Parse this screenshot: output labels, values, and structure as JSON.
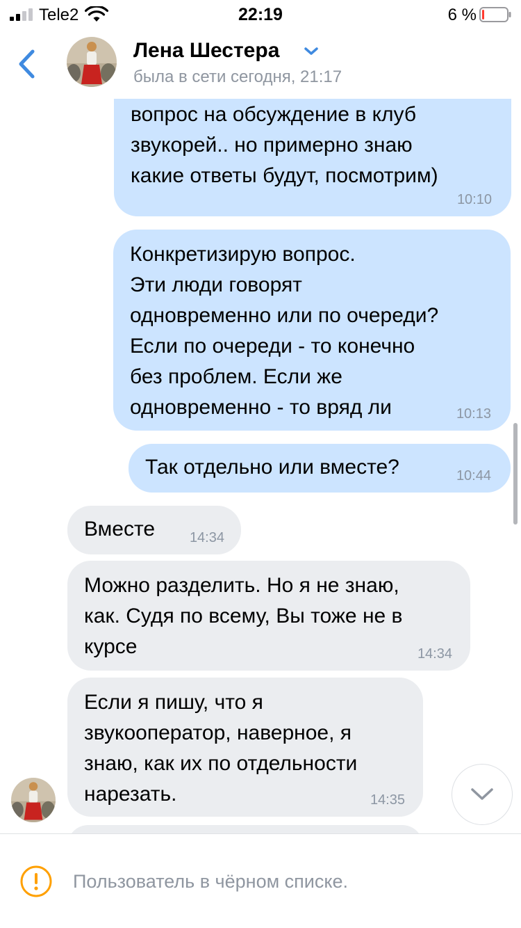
{
  "status_bar": {
    "carrier": "Tele2",
    "time": "22:19",
    "battery_percent": "6 %",
    "signal_bars": 2,
    "battery_level": 0.06,
    "battery_color": "#ff3b30"
  },
  "header": {
    "back_icon": "chevron-left-icon",
    "contact_name": "Лена Шестера",
    "last_seen": "была в сети сегодня, 21:17",
    "accent_color": "#3f8ae0"
  },
  "messages": [
    {
      "direction": "outgoing",
      "text": "вопрос на обсуждение в клуб\nзвукорей.. но примерно знаю\nкакие ответы будут, посмотрим)",
      "time": "10:10"
    },
    {
      "direction": "outgoing",
      "text": "Конкретизирую вопрос.\nЭти люди говорят\nодновременно или по очереди?\nЕсли по очереди - то конечно\nбез проблем. Если же\nодновременно - то вряд ли",
      "time": "10:13"
    },
    {
      "direction": "outgoing",
      "text": "Так отдельно или вместе?",
      "time": "10:44"
    },
    {
      "direction": "incoming",
      "text": "Вместе",
      "time": "14:34"
    },
    {
      "direction": "incoming",
      "text": "Можно разделить. Но я не знаю,\nкак. Судя по всему, Вы тоже не в\nкурсе",
      "time": "14:34"
    },
    {
      "direction": "incoming",
      "text": "Если я пишу, что я\nзвукооператор, наверное, я\nзнаю, как их по отдельности\nнарезать.",
      "time": "14:35"
    }
  ],
  "colors": {
    "outgoing_bubble": "#cce4ff",
    "incoming_bubble": "#ebedf0",
    "warning": "#ffa000"
  },
  "footer": {
    "icon": "warning-icon",
    "text": "Пользователь в чёрном списке."
  }
}
